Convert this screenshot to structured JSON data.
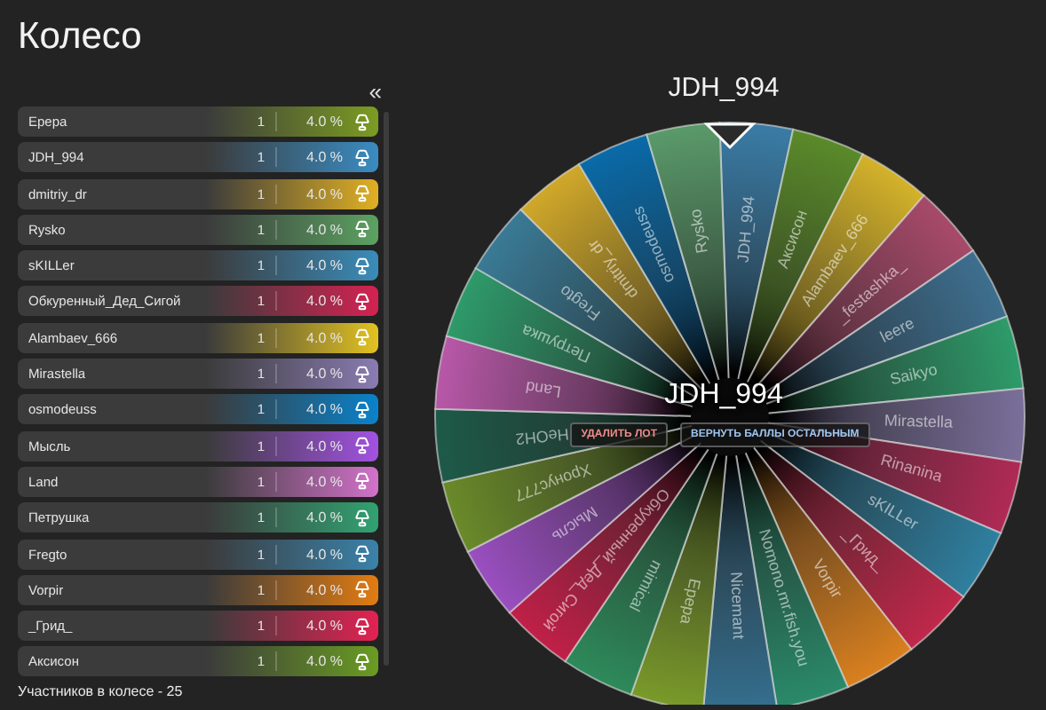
{
  "title": "Колесо",
  "collapse_button": "«",
  "participants": [
    {
      "name": "Epepa",
      "count": "1",
      "percent": "4.0 %",
      "color": "#7c9c22"
    },
    {
      "name": "JDH_994",
      "count": "1",
      "percent": "4.0 %",
      "color": "#3a8cc2"
    },
    {
      "name": "dmitriy_dr",
      "count": "1",
      "percent": "4.0 %",
      "color": "#e0b024"
    },
    {
      "name": "Rysko",
      "count": "1",
      "percent": "4.0 %",
      "color": "#5ca262"
    },
    {
      "name": "sKILLer",
      "count": "1",
      "percent": "4.0 %",
      "color": "#3a8cba"
    },
    {
      "name": "Обкуренный_Дед_Сигой",
      "count": "1",
      "percent": "4.0 %",
      "color": "#d42252"
    },
    {
      "name": "Alambaev_666",
      "count": "1",
      "percent": "4.0 %",
      "color": "#e2c222"
    },
    {
      "name": "Mirastella",
      "count": "1",
      "percent": "4.0 %",
      "color": "#8a7cb2"
    },
    {
      "name": "osmodeuss",
      "count": "1",
      "percent": "4.0 %",
      "color": "#0a82ca"
    },
    {
      "name": "Мысль",
      "count": "1",
      "percent": "4.0 %",
      "color": "#a252e2"
    },
    {
      "name": "Land",
      "count": "1",
      "percent": "4.0 %",
      "color": "#d272ca"
    },
    {
      "name": "Петрушка",
      "count": "1",
      "percent": "4.0 %",
      "color": "#32a272"
    },
    {
      "name": "Fregto",
      "count": "1",
      "percent": "4.0 %",
      "color": "#3a82aa"
    },
    {
      "name": "Vorpir",
      "count": "1",
      "percent": "4.0 %",
      "color": "#e27c12"
    },
    {
      "name": "_Грид_",
      "count": "1",
      "percent": "4.0 %",
      "color": "#e22252"
    },
    {
      "name": "Аксисон",
      "count": "1",
      "percent": "4.0 %",
      "color": "#6a9c22"
    }
  ],
  "footer": "Участников в колесе - 25",
  "winner_title": "JDH_994",
  "wheel": {
    "center_label": "JDH_994",
    "buttons": [
      {
        "label": "УДАЛИТЬ ЛОТ",
        "kind": "danger"
      },
      {
        "label": "ВЕРНУТЬ БАЛЛЫ ОСТАЛЬНЫМ",
        "kind": "primary"
      }
    ],
    "segments": [
      {
        "label": "JDH_994",
        "color": "#3a7ca6"
      },
      {
        "label": "Аксисон",
        "color": "#5a8a2a"
      },
      {
        "label": "Alambaev_666",
        "color": "#d4b22a"
      },
      {
        "label": "_festashka_",
        "color": "#a84a6a"
      },
      {
        "label": "leere",
        "color": "#3e6f8f"
      },
      {
        "label": "Saikyo",
        "color": "#2e9b6a"
      },
      {
        "label": "Mirastella",
        "color": "#7a6f9a"
      },
      {
        "label": "Rinanina",
        "color": "#b02a56"
      },
      {
        "label": "sKILLer",
        "color": "#2f7f9f"
      },
      {
        "label": "_Грид_",
        "color": "#c0284a"
      },
      {
        "label": "Vorpir",
        "color": "#d9801f"
      },
      {
        "label": "Nomono.mr.fish.you",
        "color": "#2a8a6a"
      },
      {
        "label": "Nicemant",
        "color": "#356f8f"
      },
      {
        "label": "Epepa",
        "color": "#7a9a2a"
      },
      {
        "label": "mimical",
        "color": "#2e8a5a"
      },
      {
        "label": "Обкуренный_Дед_Сигой",
        "color": "#c02048"
      },
      {
        "label": "Мысль",
        "color": "#9a4fc0"
      },
      {
        "label": "Хронус777",
        "color": "#6a8a2a"
      },
      {
        "label": "HeOH2",
        "color": "#1e5a48"
      },
      {
        "label": "Land",
        "color": "#b858a8"
      },
      {
        "label": "Петрушка",
        "color": "#2e9a6a"
      },
      {
        "label": "Fregto",
        "color": "#3a7a95"
      },
      {
        "label": "dmitriy_dr",
        "color": "#d0a82a"
      },
      {
        "label": "osmodeuss",
        "color": "#0a6aa8"
      },
      {
        "label": "Rysko",
        "color": "#5a9a6a"
      }
    ]
  }
}
